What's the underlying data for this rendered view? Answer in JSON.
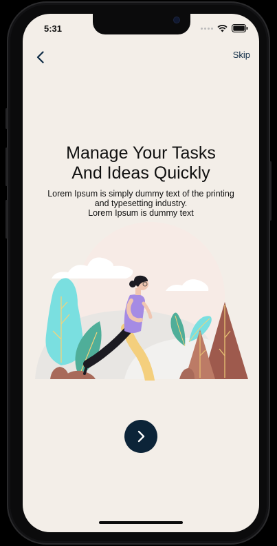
{
  "status_bar": {
    "time": "5:31"
  },
  "nav": {
    "skip_label": "Skip"
  },
  "onboarding": {
    "title_line1": "Manage Your Tasks",
    "title_line2": "And Ideas Quickly",
    "description_line1": "Lorem Ipsum is simply dummy text of the printing",
    "description_line2": "and typesetting industry.",
    "description_line3": "Lorem Ipsum is dummy text"
  },
  "icons": {
    "back": "chevron-left-icon",
    "next": "chevron-right-icon",
    "wifi": "wifi-icon",
    "battery": "battery-icon",
    "signal": "signal-icon"
  },
  "colors": {
    "background": "#f3eee8",
    "primary": "#0c2438",
    "text": "#111111"
  }
}
